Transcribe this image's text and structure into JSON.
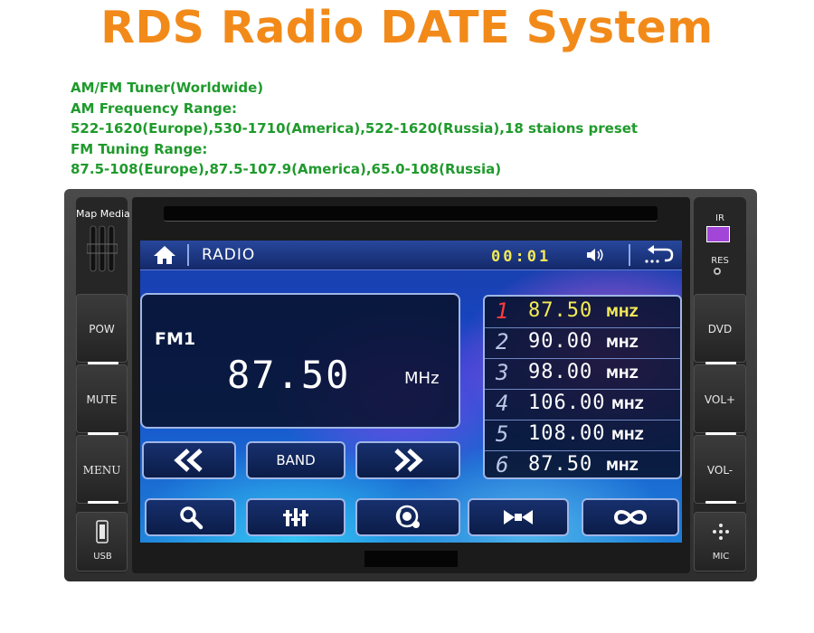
{
  "headline": "RDS Radio DATE System",
  "specs": [
    "AM/FM Tuner(Worldwide)",
    "AM Frequency Range:",
    "522-1620(Europe),530-1710(America),522-1620(Russia),18 staions preset",
    "FM Tuning Range:",
    "87.5-108(Europe),87.5-107.9(America),65.0-108(Russia)"
  ],
  "device": {
    "left_panel": {
      "label": "Map Media",
      "buttons": [
        "POW",
        "MUTE",
        "MENU"
      ],
      "usb_label": "USB"
    },
    "right_panel": {
      "ir_label": "IR",
      "res_label": "RES",
      "buttons": [
        "DVD",
        "VOL+",
        "VOL-"
      ],
      "mic_label": "MIC"
    }
  },
  "screen": {
    "title": "RADIO",
    "clock": "00:01",
    "band": "FM1",
    "frequency": "87.50",
    "unit": "MHz",
    "presets": [
      {
        "num": "1",
        "freq": "87.50",
        "unit": "MHZ",
        "active": true
      },
      {
        "num": "2",
        "freq": "90.00",
        "unit": "MHZ",
        "active": false
      },
      {
        "num": "3",
        "freq": "98.00",
        "unit": "MHZ",
        "active": false
      },
      {
        "num": "4",
        "freq": "106.00",
        "unit": "MHZ",
        "active": false
      },
      {
        "num": "5",
        "freq": "108.00",
        "unit": "MHZ",
        "active": false
      },
      {
        "num": "6",
        "freq": "87.50",
        "unit": "MHZ",
        "active": false
      }
    ],
    "controls": {
      "band_label": "BAND"
    },
    "icons": [
      "home-icon",
      "volume-icon",
      "back-icon",
      "seek-back-icon",
      "seek-forward-icon",
      "search-icon",
      "equalizer-icon",
      "rds-icon",
      "stereo-icon",
      "loop-icon"
    ]
  },
  "colors": {
    "headline": "#f28a1a",
    "specs": "#1f9a2c",
    "clock": "#f3ea55",
    "active_preset_number": "#ff3b3b",
    "ir_window": "#a146d6"
  }
}
